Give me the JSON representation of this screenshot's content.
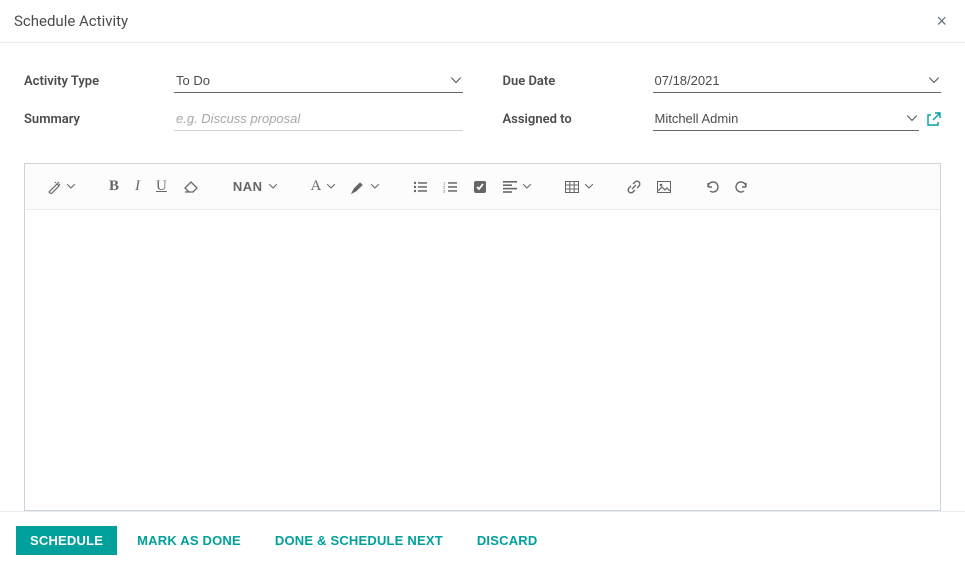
{
  "header": {
    "title": "Schedule Activity"
  },
  "form": {
    "activity_type": {
      "label": "Activity Type",
      "value": "To Do"
    },
    "summary": {
      "label": "Summary",
      "placeholder": "e.g. Discuss proposal",
      "value": ""
    },
    "due_date": {
      "label": "Due Date",
      "value": "07/18/2021"
    },
    "assigned_to": {
      "label": "Assigned to",
      "value": "Mitchell Admin"
    }
  },
  "toolbar": {
    "font_size_label": "NAN",
    "font_family_label": "A"
  },
  "footer": {
    "schedule": "SCHEDULE",
    "mark_done": "MARK AS DONE",
    "done_next": "DONE & SCHEDULE NEXT",
    "discard": "DISCARD"
  }
}
